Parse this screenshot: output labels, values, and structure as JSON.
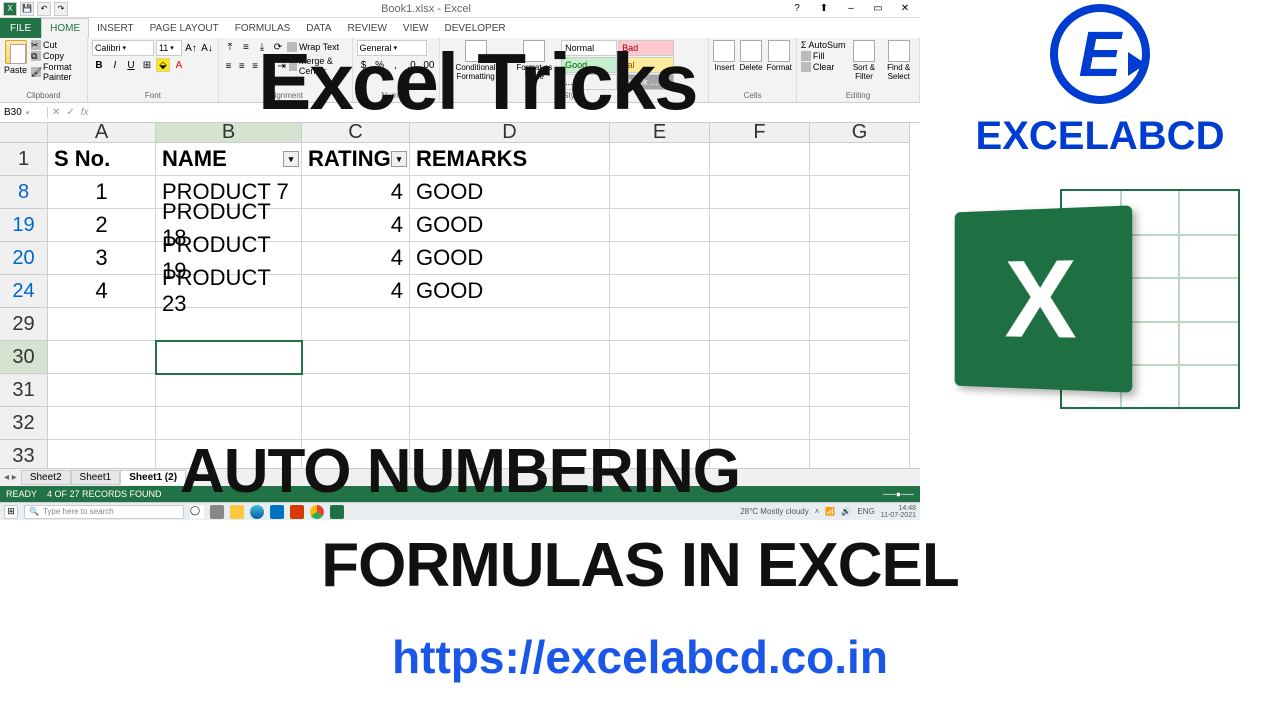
{
  "titlebar": {
    "title": "Book1.xlsx - Excel"
  },
  "win_controls": {
    "min": "–",
    "max": "▭",
    "close": "✕",
    "rib": "⬆",
    "help": "?"
  },
  "ribbon_tabs": {
    "file": "FILE",
    "home": "HOME",
    "insert": "INSERT",
    "page": "PAGE LAYOUT",
    "formulas": "FORMULAS",
    "data": "DATA",
    "review": "REVIEW",
    "view": "VIEW",
    "dev": "DEVELOPER"
  },
  "clipboard": {
    "paste": "Paste",
    "cut": "Cut",
    "copy": "Copy",
    "painter": "Format Painter",
    "label": "Clipboard"
  },
  "font": {
    "name": "Calibri",
    "size": "11",
    "label": "Font",
    "b": "B",
    "i": "I",
    "u": "U"
  },
  "align": {
    "wrap": "Wrap Text",
    "merge": "Merge & Center",
    "label": "Alignment"
  },
  "number": {
    "fmt": "General",
    "label": "Number"
  },
  "styles": {
    "cond": "Conditional Formatting",
    "fat": "Format as Table",
    "normal": "Normal",
    "bad": "Bad",
    "good": "Good",
    "neutral": "tral",
    "calc": "...",
    "check": "Check ...",
    "label": "Styles"
  },
  "cells": {
    "ins": "Insert",
    "del": "Delete",
    "fmt": "Format",
    "label": "Cells"
  },
  "editing": {
    "sum": "AutoSum",
    "fill": "Fill",
    "clear": "Clear",
    "sort": "Sort & Filter",
    "find": "Find & Select",
    "label": "Editing"
  },
  "namebox": "B30",
  "fx": {
    "fx": "fx"
  },
  "columns": {
    "A": "A",
    "B": "B",
    "C": "C",
    "D": "D",
    "E": "E",
    "F": "F",
    "G": "G"
  },
  "headers": {
    "a": "S No.",
    "b": "NAME",
    "c": "RATING",
    "d": "REMARKS"
  },
  "rows": [
    {
      "num": "1"
    },
    {
      "num": "8",
      "a": "1",
      "b": "PRODUCT 7",
      "c": "4",
      "d": "GOOD"
    },
    {
      "num": "19",
      "a": "2",
      "b": "PRODUCT 18",
      "c": "4",
      "d": "GOOD"
    },
    {
      "num": "20",
      "a": "3",
      "b": "PRODUCT 19",
      "c": "4",
      "d": "GOOD"
    },
    {
      "num": "24",
      "a": "4",
      "b": "PRODUCT 23",
      "c": "4",
      "d": "GOOD"
    },
    {
      "num": "29"
    },
    {
      "num": "30"
    },
    {
      "num": "31"
    },
    {
      "num": "32"
    },
    {
      "num": "33"
    }
  ],
  "sheets": {
    "s2": "Sheet2",
    "s1": "Sheet1",
    "s1c": "Sheet1 (2)",
    "add": "⊕"
  },
  "status": {
    "ready": "READY",
    "found": "4 OF 27 RECORDS FOUND"
  },
  "taskbar": {
    "search": "Type here to search",
    "weather": "28°C  Mostly cloudy",
    "lang": "ENG",
    "time": "14:48",
    "date": "11-07-2021"
  },
  "overlays": {
    "t1": "Excel Tricks",
    "t2": "AUTO NUMBERING",
    "t3": "FORMULAS IN EXCEL",
    "url": "https://excelabcd.co.in"
  },
  "brand": {
    "name": "EXCELABCD",
    "e": "E",
    "x": "X"
  }
}
